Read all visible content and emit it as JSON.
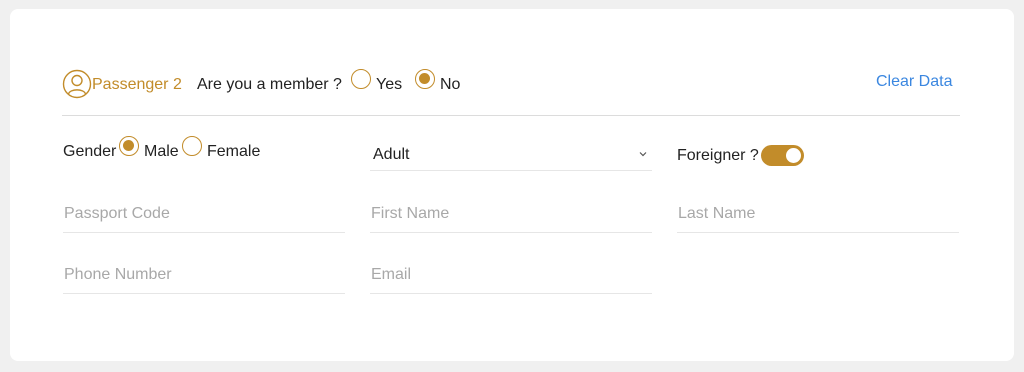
{
  "passenger": {
    "title": "Passenger 2",
    "icon": "user-circle-icon"
  },
  "member": {
    "question": "Are you a member ?",
    "options": [
      {
        "label": "Yes",
        "checked": false
      },
      {
        "label": "No",
        "checked": true
      }
    ]
  },
  "clear_data_label": "Clear Data",
  "gender": {
    "label": "Gender",
    "options": [
      {
        "label": "Male",
        "checked": true
      },
      {
        "label": "Female",
        "checked": false
      }
    ]
  },
  "passenger_type": {
    "selected": "Adult",
    "icon": "chevron-down-icon"
  },
  "foreigner": {
    "label": "Foreigner ?",
    "on": true
  },
  "fields": {
    "passport_placeholder": "Passport Code",
    "first_name_placeholder": "First Name",
    "last_name_placeholder": "Last Name",
    "phone_placeholder": "Phone Number",
    "email_placeholder": "Email"
  },
  "colors": {
    "accent": "#c28c2a",
    "link": "#3b87e0",
    "placeholder": "#a8a8a8"
  }
}
